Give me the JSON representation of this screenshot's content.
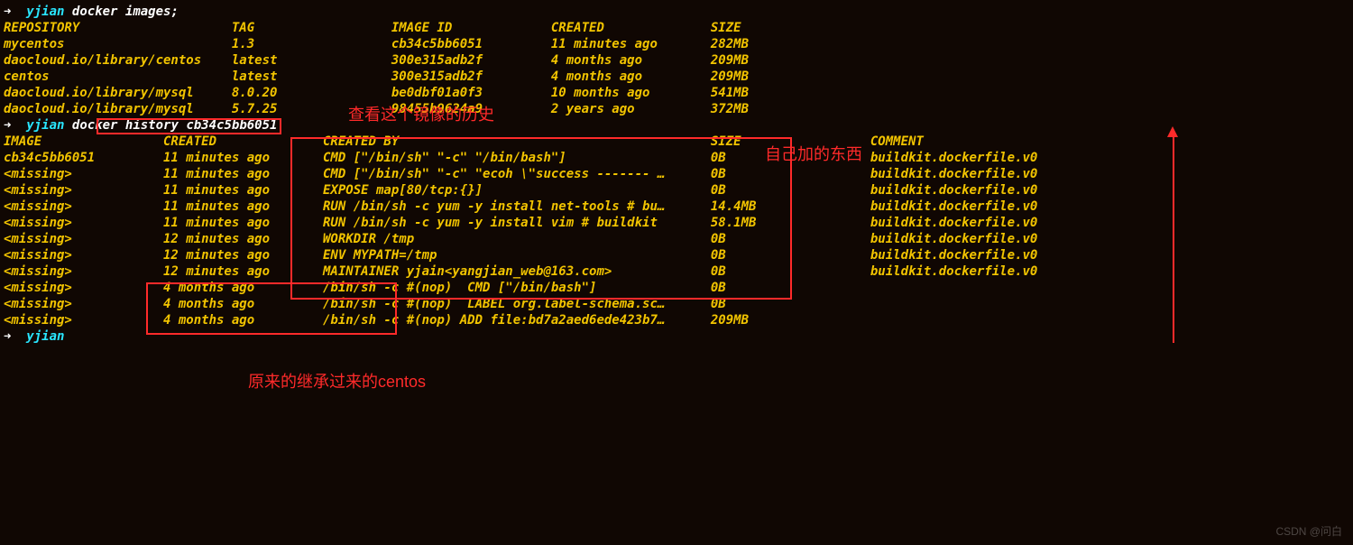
{
  "prompt_arrow": "➜",
  "prompt_user": "yjian",
  "cmd1": "docker images;",
  "images_header": {
    "repository": "REPOSITORY",
    "tag": "TAG",
    "image_id": "IMAGE ID",
    "created": "CREATED",
    "size": "SIZE"
  },
  "images": [
    {
      "repository": "mycentos",
      "tag": "1.3",
      "image_id": "cb34c5bb6051",
      "created": "11 minutes ago",
      "size": "282MB"
    },
    {
      "repository": "daocloud.io/library/centos",
      "tag": "latest",
      "image_id": "300e315adb2f",
      "created": "4 months ago",
      "size": "209MB"
    },
    {
      "repository": "centos",
      "tag": "latest",
      "image_id": "300e315adb2f",
      "created": "4 months ago",
      "size": "209MB"
    },
    {
      "repository": "daocloud.io/library/mysql",
      "tag": "8.0.20",
      "image_id": "be0dbf01a0f3",
      "created": "10 months ago",
      "size": "541MB"
    },
    {
      "repository": "daocloud.io/library/mysql",
      "tag": "5.7.25",
      "image_id": "98455b9624a9",
      "created": "2 years ago",
      "size": "372MB"
    }
  ],
  "cmd2": "docker history cb34c5bb6051",
  "history_header": {
    "image": "IMAGE",
    "created": "CREATED",
    "created_by": "CREATED BY",
    "size": "SIZE",
    "comment": "COMMENT"
  },
  "history": [
    {
      "image": "cb34c5bb6051",
      "created": "11 minutes ago",
      "created_by": "CMD [\"/bin/sh\" \"-c\" \"/bin/bash\"]",
      "size": "0B",
      "comment": "buildkit.dockerfile.v0"
    },
    {
      "image": "<missing>",
      "created": "11 minutes ago",
      "created_by": "CMD [\"/bin/sh\" \"-c\" \"ecoh \\\"success ------- …",
      "size": "0B",
      "comment": "buildkit.dockerfile.v0"
    },
    {
      "image": "<missing>",
      "created": "11 minutes ago",
      "created_by": "EXPOSE map[80/tcp:{}]",
      "size": "0B",
      "comment": "buildkit.dockerfile.v0"
    },
    {
      "image": "<missing>",
      "created": "11 minutes ago",
      "created_by": "RUN /bin/sh -c yum -y install net-tools # bu…",
      "size": "14.4MB",
      "comment": "buildkit.dockerfile.v0"
    },
    {
      "image": "<missing>",
      "created": "11 minutes ago",
      "created_by": "RUN /bin/sh -c yum -y install vim # buildkit",
      "size": "58.1MB",
      "comment": "buildkit.dockerfile.v0"
    },
    {
      "image": "<missing>",
      "created": "12 minutes ago",
      "created_by": "WORKDIR /tmp",
      "size": "0B",
      "comment": "buildkit.dockerfile.v0"
    },
    {
      "image": "<missing>",
      "created": "12 minutes ago",
      "created_by": "ENV MYPATH=/tmp",
      "size": "0B",
      "comment": "buildkit.dockerfile.v0"
    },
    {
      "image": "<missing>",
      "created": "12 minutes ago",
      "created_by": "MAINTAINER yjain<yangjian_web@163.com>",
      "size": "0B",
      "comment": "buildkit.dockerfile.v0"
    },
    {
      "image": "<missing>",
      "created": "4 months ago",
      "created_by": "/bin/sh -c #(nop)  CMD [\"/bin/bash\"]",
      "size": "0B",
      "comment": ""
    },
    {
      "image": "<missing>",
      "created": "4 months ago",
      "created_by": "/bin/sh -c #(nop)  LABEL org.label-schema.sc…",
      "size": "0B",
      "comment": ""
    },
    {
      "image": "<missing>",
      "created": "4 months ago",
      "created_by": "/bin/sh -c #(nop) ADD file:bd7a2aed6ede423b7…",
      "size": "209MB",
      "comment": ""
    }
  ],
  "annotations": {
    "a1": "查看这个镜像的历史",
    "a2": "自己加的东西",
    "a3": "原来的继承过来的centos"
  },
  "watermark": "CSDN @问白"
}
